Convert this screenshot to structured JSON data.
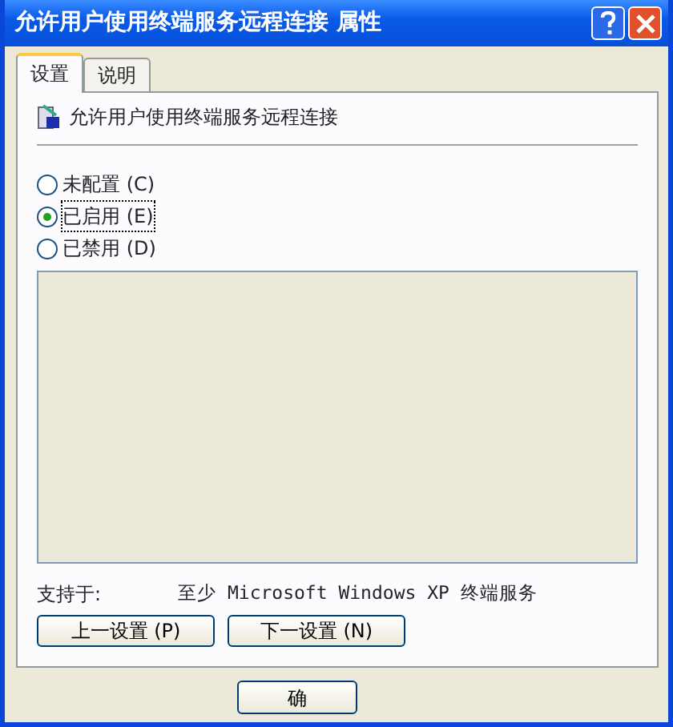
{
  "window": {
    "title": "允许用户使用终端服务远程连接 属性"
  },
  "tabs": [
    {
      "label": "设置",
      "selected": true
    },
    {
      "label": "说明",
      "selected": false
    }
  ],
  "setting": {
    "name": "允许用户使用终端服务远程连接"
  },
  "options": [
    {
      "label": "未配置 (C)",
      "selected": false
    },
    {
      "label": "已启用 (E)",
      "selected": true
    },
    {
      "label": "已禁用 (D)",
      "selected": false
    }
  ],
  "supported": {
    "label": "支持于:",
    "value": "至少 Microsoft Windows XP 终端服务"
  },
  "nav_buttons": [
    "上一设置 (P)",
    "下一设置 (N)"
  ],
  "dialog_buttons": [
    "确"
  ]
}
